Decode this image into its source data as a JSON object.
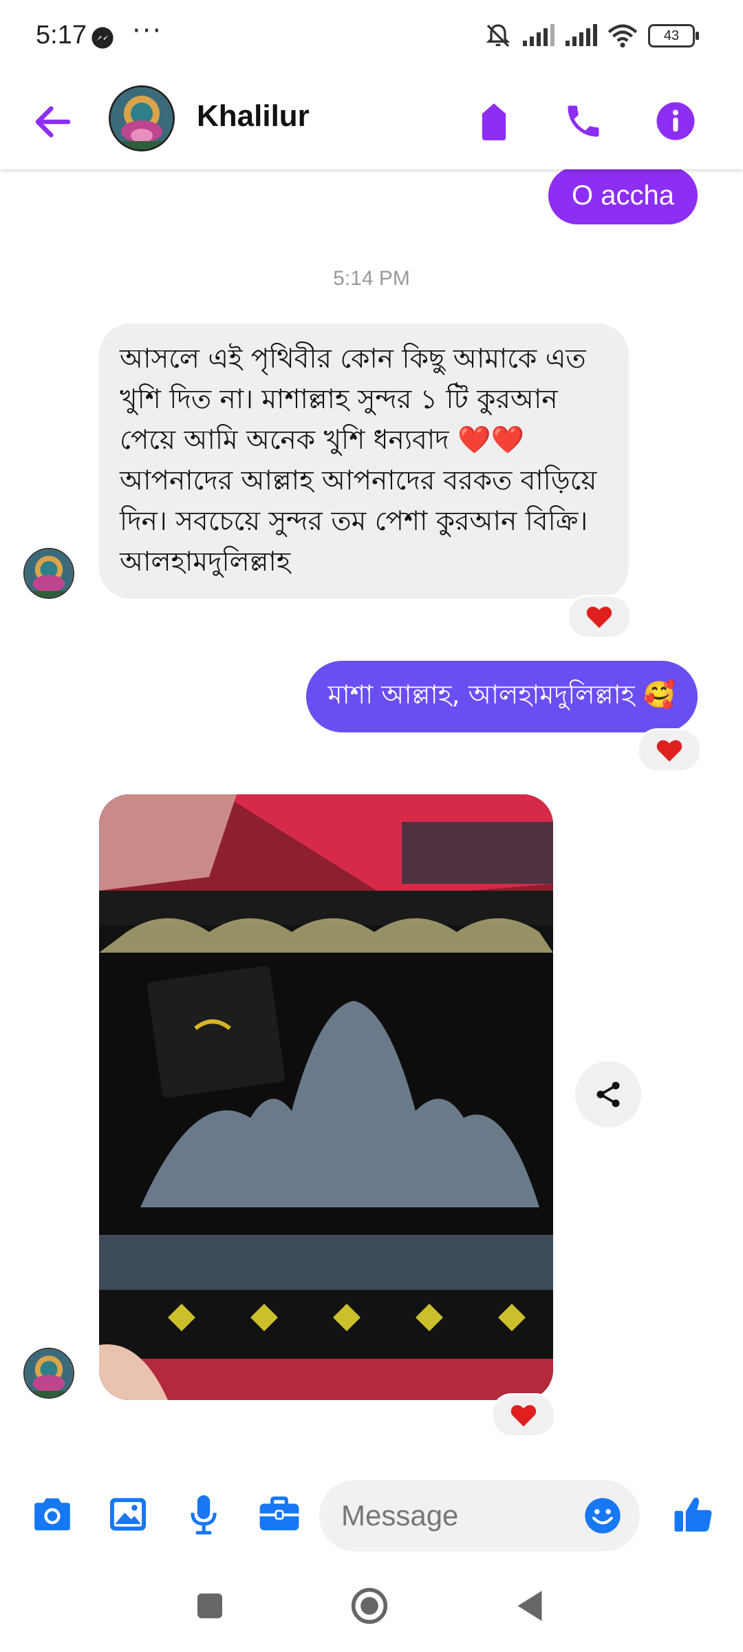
{
  "status_bar": {
    "time": "5:17",
    "more": "···",
    "battery": "43"
  },
  "header": {
    "contact_name": "Khalilur"
  },
  "messages": {
    "outgoing_short": "O accha",
    "timestamp": "5:14 PM",
    "incoming_text": "আসলে এই পৃথিবীর  কোন কিছু আমাকে এত খুশি দিত না। মাশাল্লাহ সুন্দর ১ টি কুরআন পেয়ে আমি অনেক খুশি ধন্যবাদ ❤️❤️আপনাদের আল্লাহ আপনাদের বরকত বাড়িয়ে দিন। সবচেয়ে সুন্দর তম পেশা কুরআন বিক্রি।আলহামদুলিল্লাহ",
    "outgoing_reply": "মাশা আল্লাহ, আলহামদুলিল্লাহ 🥰",
    "reaction": "❤️"
  },
  "composer": {
    "placeholder": "Message"
  },
  "colors": {
    "accent": "#8d2ef3",
    "outgoing_bubble": "#6a4ef2",
    "incoming_bubble": "#efefef",
    "composer_icons": "#1877f2",
    "reaction_heart": "#e0201f"
  }
}
